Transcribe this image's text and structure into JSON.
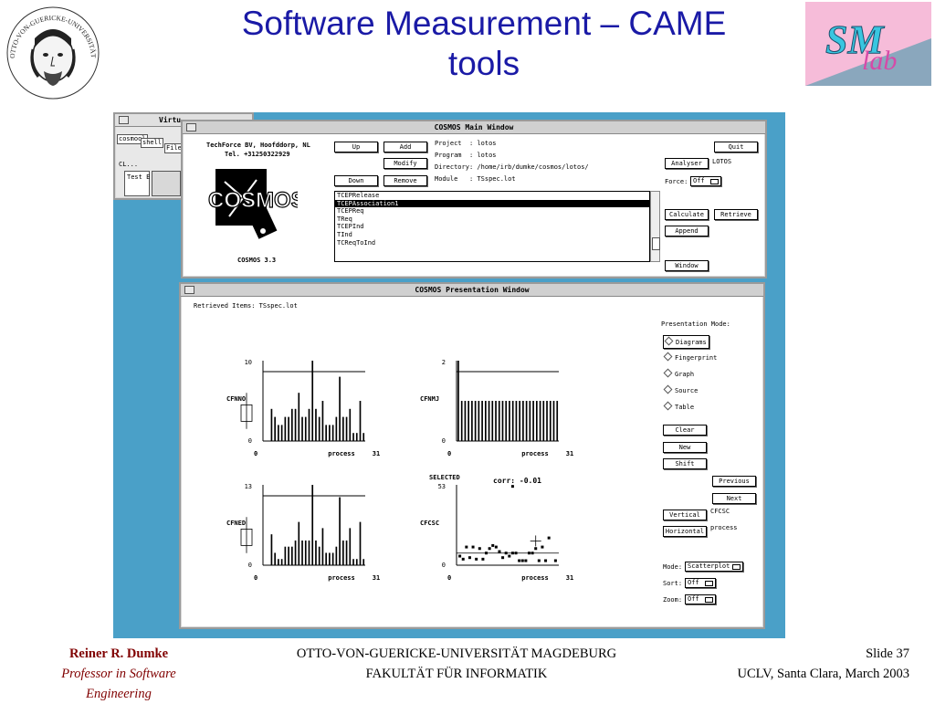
{
  "slide": {
    "title_line1": "Software Measurement – CAME",
    "title_line2": "tools"
  },
  "seal": {
    "text": "OTTO-VON-GUERICKE-UNIVERSITÄT MAGDEBURG"
  },
  "logo": {
    "text_sm": "SM",
    "text_lab": "lab"
  },
  "bg_window": {
    "title": "Virtu",
    "items": [
      "cosmool",
      "shell",
      "File M",
      "Test E",
      "CL..."
    ]
  },
  "main_window": {
    "title": "COSMOS Main Window",
    "company_line1": "TechForce BV, Hoofddorp, NL",
    "company_line2": "Tel. +31250322929",
    "version": "COSMOS 3.3",
    "logo_word": "COSMOS",
    "buttons": {
      "up": "Up",
      "add": "Add",
      "modify": "Modify",
      "down": "Down",
      "remove": "Remove",
      "quit": "Quit",
      "analyser": "Analyser",
      "calculate": "Calculate",
      "retrieve": "Retrieve",
      "append": "Append",
      "window": "Window"
    },
    "info": [
      {
        "label": "Project",
        "value": ": lotos"
      },
      {
        "label": "Program",
        "value": ": lotos"
      },
      {
        "label": "Directory",
        "value": ": /home/irb/dumke/cosmos/lotos/"
      },
      {
        "label": "Module",
        "value": ": TSspec.lot"
      }
    ],
    "analyser_value": "LOTOS",
    "force_label": "Force:",
    "force_value": "Off",
    "list_items": [
      "TCEPRelease",
      "TCEPAssociation1",
      "TCEPReq",
      "TReq",
      "TCEPInd",
      "TInd",
      "TCReqToInd"
    ],
    "list_selected": 1
  },
  "presentation_window": {
    "title": "COSMOS Presentation Window",
    "retrieved": "Retrieved Items: TSspec.lot",
    "mode_heading": "Presentation Mode:",
    "modes": [
      "Diagrams",
      "Fingerprint",
      "Graph",
      "Source",
      "Table"
    ],
    "mode_selected": 0,
    "buttons": {
      "clear": "Clear",
      "new": "New",
      "shift": "Shift",
      "previous": "Previous",
      "next": "Next",
      "vertical": "Vertical",
      "horizontal": "Horizontal"
    },
    "vertical_value": "CFCSC",
    "horizontal_value": "process",
    "mode_label": "Mode:",
    "mode_value": "Scatterplot",
    "sort_label": "Sort:",
    "sort_value": "Off",
    "zoom_label": "Zoom:",
    "zoom_value": "Off"
  },
  "chart_data": [
    {
      "type": "bar",
      "ylabel": "CFNNO",
      "xlabel": "process",
      "xlim": [
        0,
        31
      ],
      "ylim": [
        0,
        10
      ],
      "ytick_top": "10",
      "ytick_bottom": "0",
      "xtick_left": "0",
      "xtick_right": "31",
      "values": [
        0,
        0,
        4,
        3,
        2,
        2,
        3,
        3,
        4,
        4,
        6,
        3,
        3,
        4,
        10,
        4,
        3,
        5,
        2,
        2,
        2,
        3,
        8,
        3,
        3,
        4,
        1,
        1,
        5,
        1
      ]
    },
    {
      "type": "bar",
      "ylabel": "CFNMJ",
      "xlabel": "process",
      "xlim": [
        0,
        31
      ],
      "ylim": [
        0,
        2
      ],
      "ytick_top": "2",
      "ytick_bottom": "0",
      "xtick_left": "0",
      "xtick_right": "31",
      "values": [
        2,
        1,
        1,
        1,
        1,
        1,
        1,
        1,
        1,
        1,
        1,
        1,
        1,
        1,
        1,
        1,
        1,
        1,
        1,
        1,
        1,
        1,
        1,
        1,
        1,
        1,
        1,
        1,
        1,
        1
      ]
    },
    {
      "type": "bar",
      "ylabel": "CFNED",
      "xlabel": "process",
      "xlim": [
        0,
        31
      ],
      "ylim": [
        0,
        13
      ],
      "ytick_top": "13",
      "ytick_bottom": "0",
      "xtick_left": "0",
      "xtick_right": "31",
      "values": [
        0,
        0,
        5,
        2,
        1,
        1,
        3,
        3,
        3,
        4,
        7,
        4,
        4,
        4,
        13,
        4,
        3,
        6,
        2,
        2,
        2,
        3,
        11,
        4,
        4,
        6,
        1,
        1,
        7,
        1
      ]
    },
    {
      "type": "scatter",
      "ylabel": "CFCSC",
      "xlabel": "process",
      "xlim": [
        0,
        31
      ],
      "ylim": [
        0,
        53
      ],
      "ytick_top": "53",
      "ytick_bottom": "0",
      "xtick_left": "0",
      "xtick_right": "31",
      "annotation_left": "SELECTED",
      "annotation_right": "corr: -0.01",
      "points": [
        [
          1,
          6
        ],
        [
          2,
          4
        ],
        [
          3,
          12
        ],
        [
          4,
          5
        ],
        [
          5,
          12
        ],
        [
          6,
          4
        ],
        [
          7,
          11
        ],
        [
          8,
          4
        ],
        [
          9,
          8
        ],
        [
          10,
          11
        ],
        [
          11,
          13
        ],
        [
          12,
          12
        ],
        [
          13,
          9
        ],
        [
          14,
          5
        ],
        [
          15,
          8
        ],
        [
          16,
          6
        ],
        [
          17,
          8
        ],
        [
          18,
          8
        ],
        [
          19,
          3
        ],
        [
          20,
          3
        ],
        [
          21,
          3
        ],
        [
          22,
          8
        ],
        [
          23,
          8
        ],
        [
          24,
          11
        ],
        [
          25,
          3
        ],
        [
          26,
          12
        ],
        [
          27,
          3
        ],
        [
          28,
          18
        ],
        [
          30,
          3
        ],
        [
          17,
          52
        ]
      ],
      "marker": [
        24,
        16
      ]
    }
  ],
  "footer": {
    "author": "Reiner R. Dumke",
    "role": "Professor in Software Engineering",
    "uni_line1": "OTTO-VON-GUERICKE-UNIVERSITÄT MAGDEBURG",
    "uni_line2": "FAKULTÄT FÜR INFORMATIK",
    "slide_num": "Slide 37",
    "event": "UCLV, Santa Clara, March 2003"
  }
}
